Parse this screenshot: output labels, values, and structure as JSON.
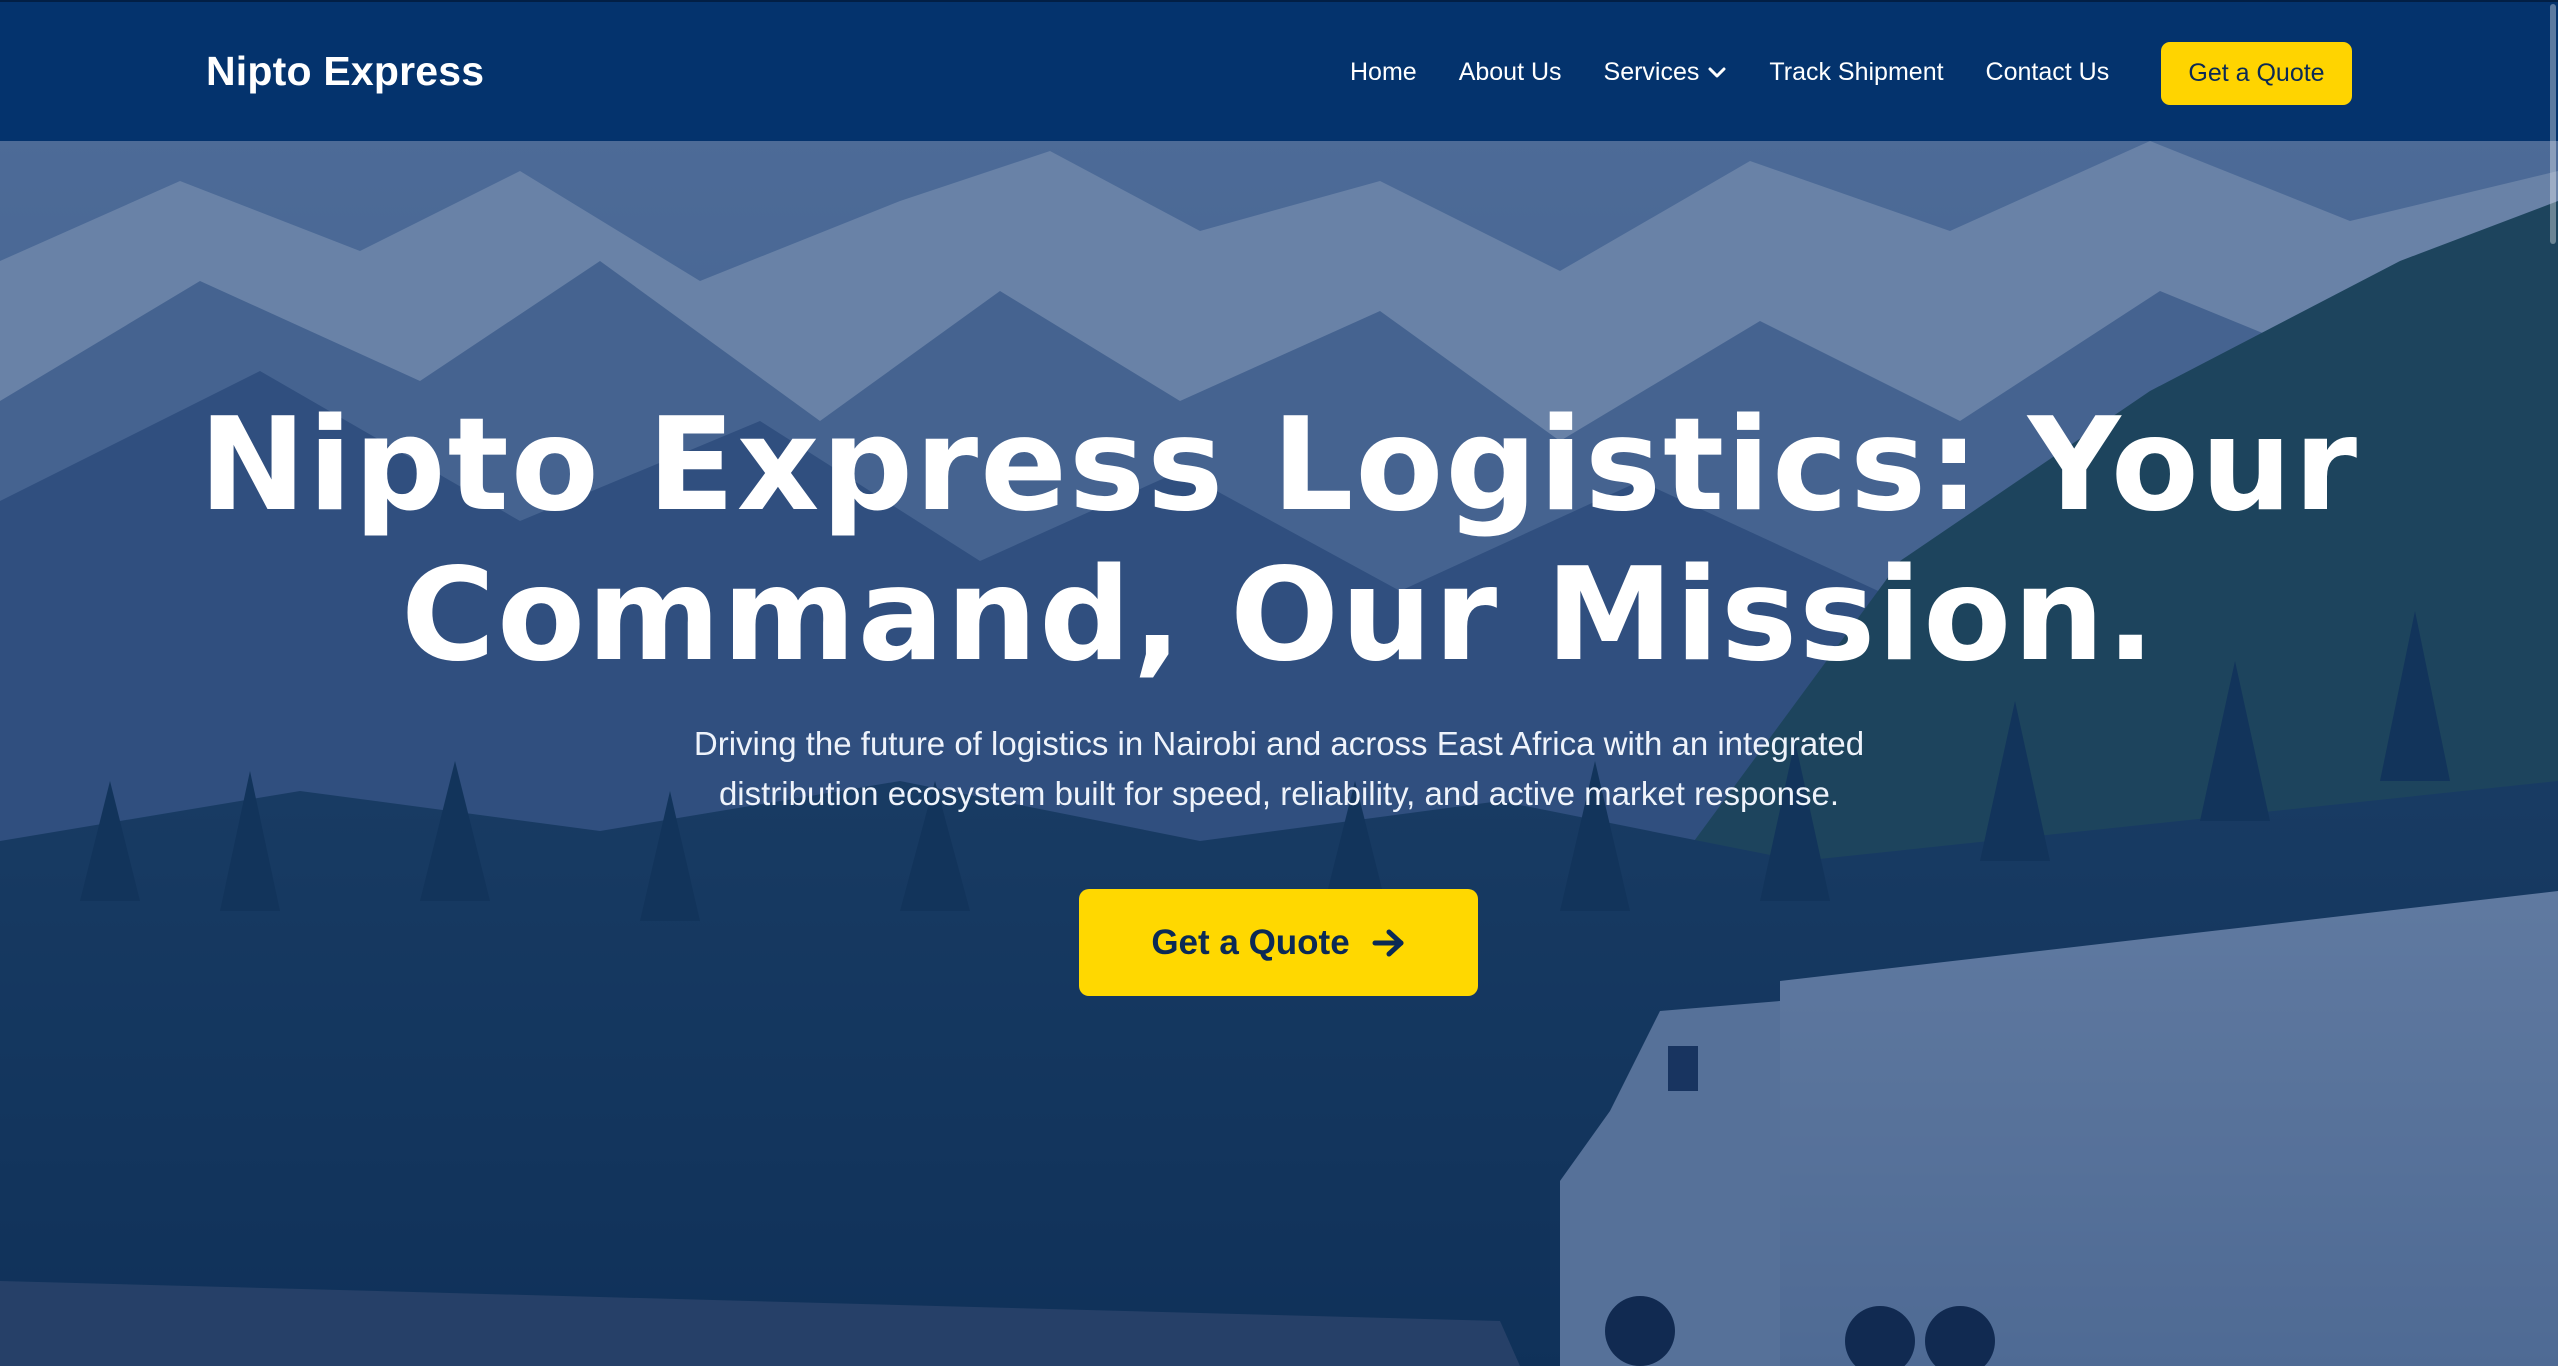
{
  "brand": {
    "name": "Nipto Express"
  },
  "nav": {
    "items": [
      {
        "label": "Home"
      },
      {
        "label": "About Us"
      },
      {
        "label": "Services",
        "has_dropdown": true
      },
      {
        "label": "Track Shipment"
      },
      {
        "label": "Contact Us"
      }
    ],
    "cta_label": "Get a Quote"
  },
  "hero": {
    "headline_line1": "Nipto Express Logistics: Your",
    "headline_line2": "Command, Our Mission.",
    "subtext_line1": "Driving the future of logistics in Nairobi and across East Africa with an integrated",
    "subtext_line2": "distribution ecosystem built for speed, reliability, and active market response.",
    "cta_label": "Get a Quote",
    "cta_icon": "arrow-right-icon"
  },
  "colors": {
    "navbar": "#04336d",
    "accent": "#ffd400",
    "text_dark": "#0b2a55",
    "overlay": "#0a2f69"
  }
}
